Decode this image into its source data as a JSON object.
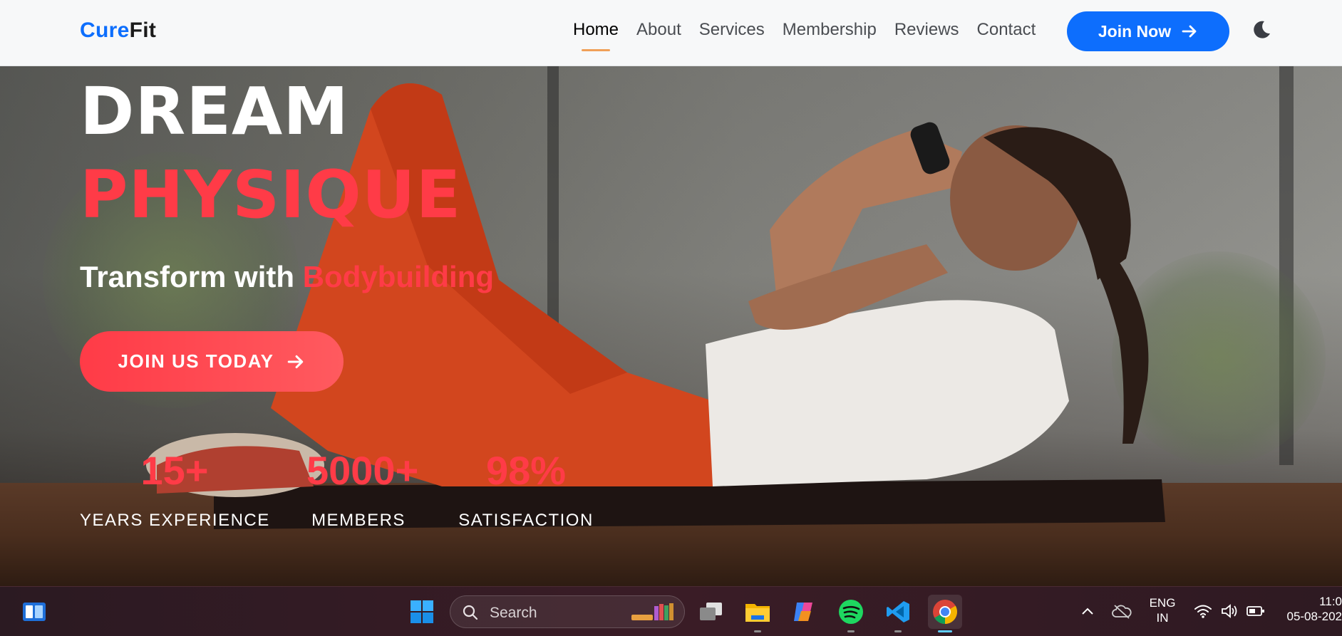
{
  "navbar": {
    "brand_part1": "Cure",
    "brand_part2": "Fit",
    "links": [
      "Home",
      "About",
      "Services",
      "Membership",
      "Reviews",
      "Contact"
    ],
    "active_link": "Home",
    "join_label": "Join Now",
    "theme_toggle_icon": "moon-icon"
  },
  "hero": {
    "title_line1": "DREAM",
    "title_line2": "PHYSIQUE",
    "tagline_prefix": "Transform with",
    "tagline_accent": "Bodybuilding",
    "cta_label": "JOIN US TODAY",
    "stats": [
      {
        "value": "15+",
        "label": "YEARS EXPERIENCE"
      },
      {
        "value": "5000+",
        "label": "MEMBERS"
      },
      {
        "value": "98%",
        "label": "SATISFACTION"
      }
    ],
    "background_image": "woman-doing-crunches-on-mat"
  },
  "colors": {
    "brand_blue": "#0d6efd",
    "accent_red": "#ff3b47",
    "nav_underline": "#f0a058"
  },
  "taskbar": {
    "search_placeholder": "Search",
    "apps": [
      "widgets-icon",
      "windows-start-icon",
      "search-icon",
      "task-view-icon",
      "file-explorer-icon",
      "copilot-icon",
      "spotify-icon",
      "vscode-icon",
      "chrome-icon"
    ],
    "language_line1": "ENG",
    "language_line2": "IN",
    "time": "11:0",
    "date": "05-08-202"
  }
}
